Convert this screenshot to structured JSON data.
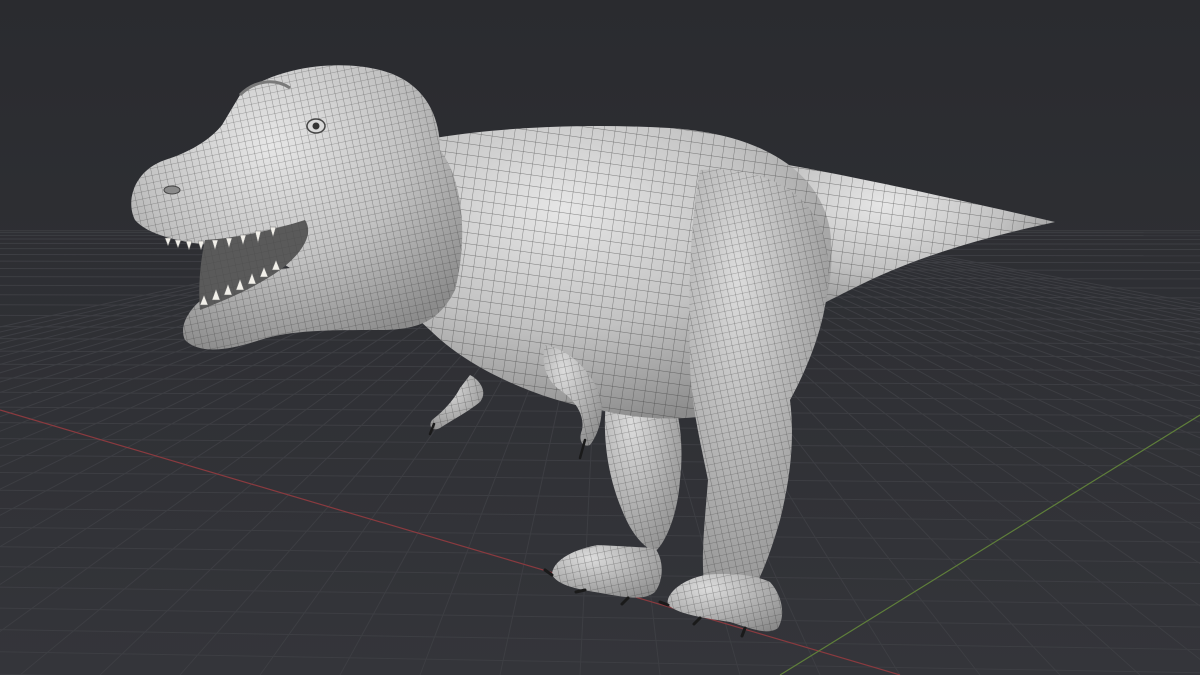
{
  "viewport": {
    "mode": "wireframe-overlay",
    "subject": "dinosaur-mesh",
    "colors": {
      "background_top": "#2a2b2f",
      "background_bottom": "#34353a",
      "grid_line": "#3d3e43",
      "axis_x": "#8a3a3f",
      "axis_y": "#5f7f3a",
      "mesh_fill": "#bdbdbd",
      "mesh_shadow": "#8e8e8e",
      "mesh_highlight": "#e4e4e4",
      "wire": "#2f2f2f",
      "teeth": "#f1efe9",
      "mouth": "#555555"
    }
  }
}
